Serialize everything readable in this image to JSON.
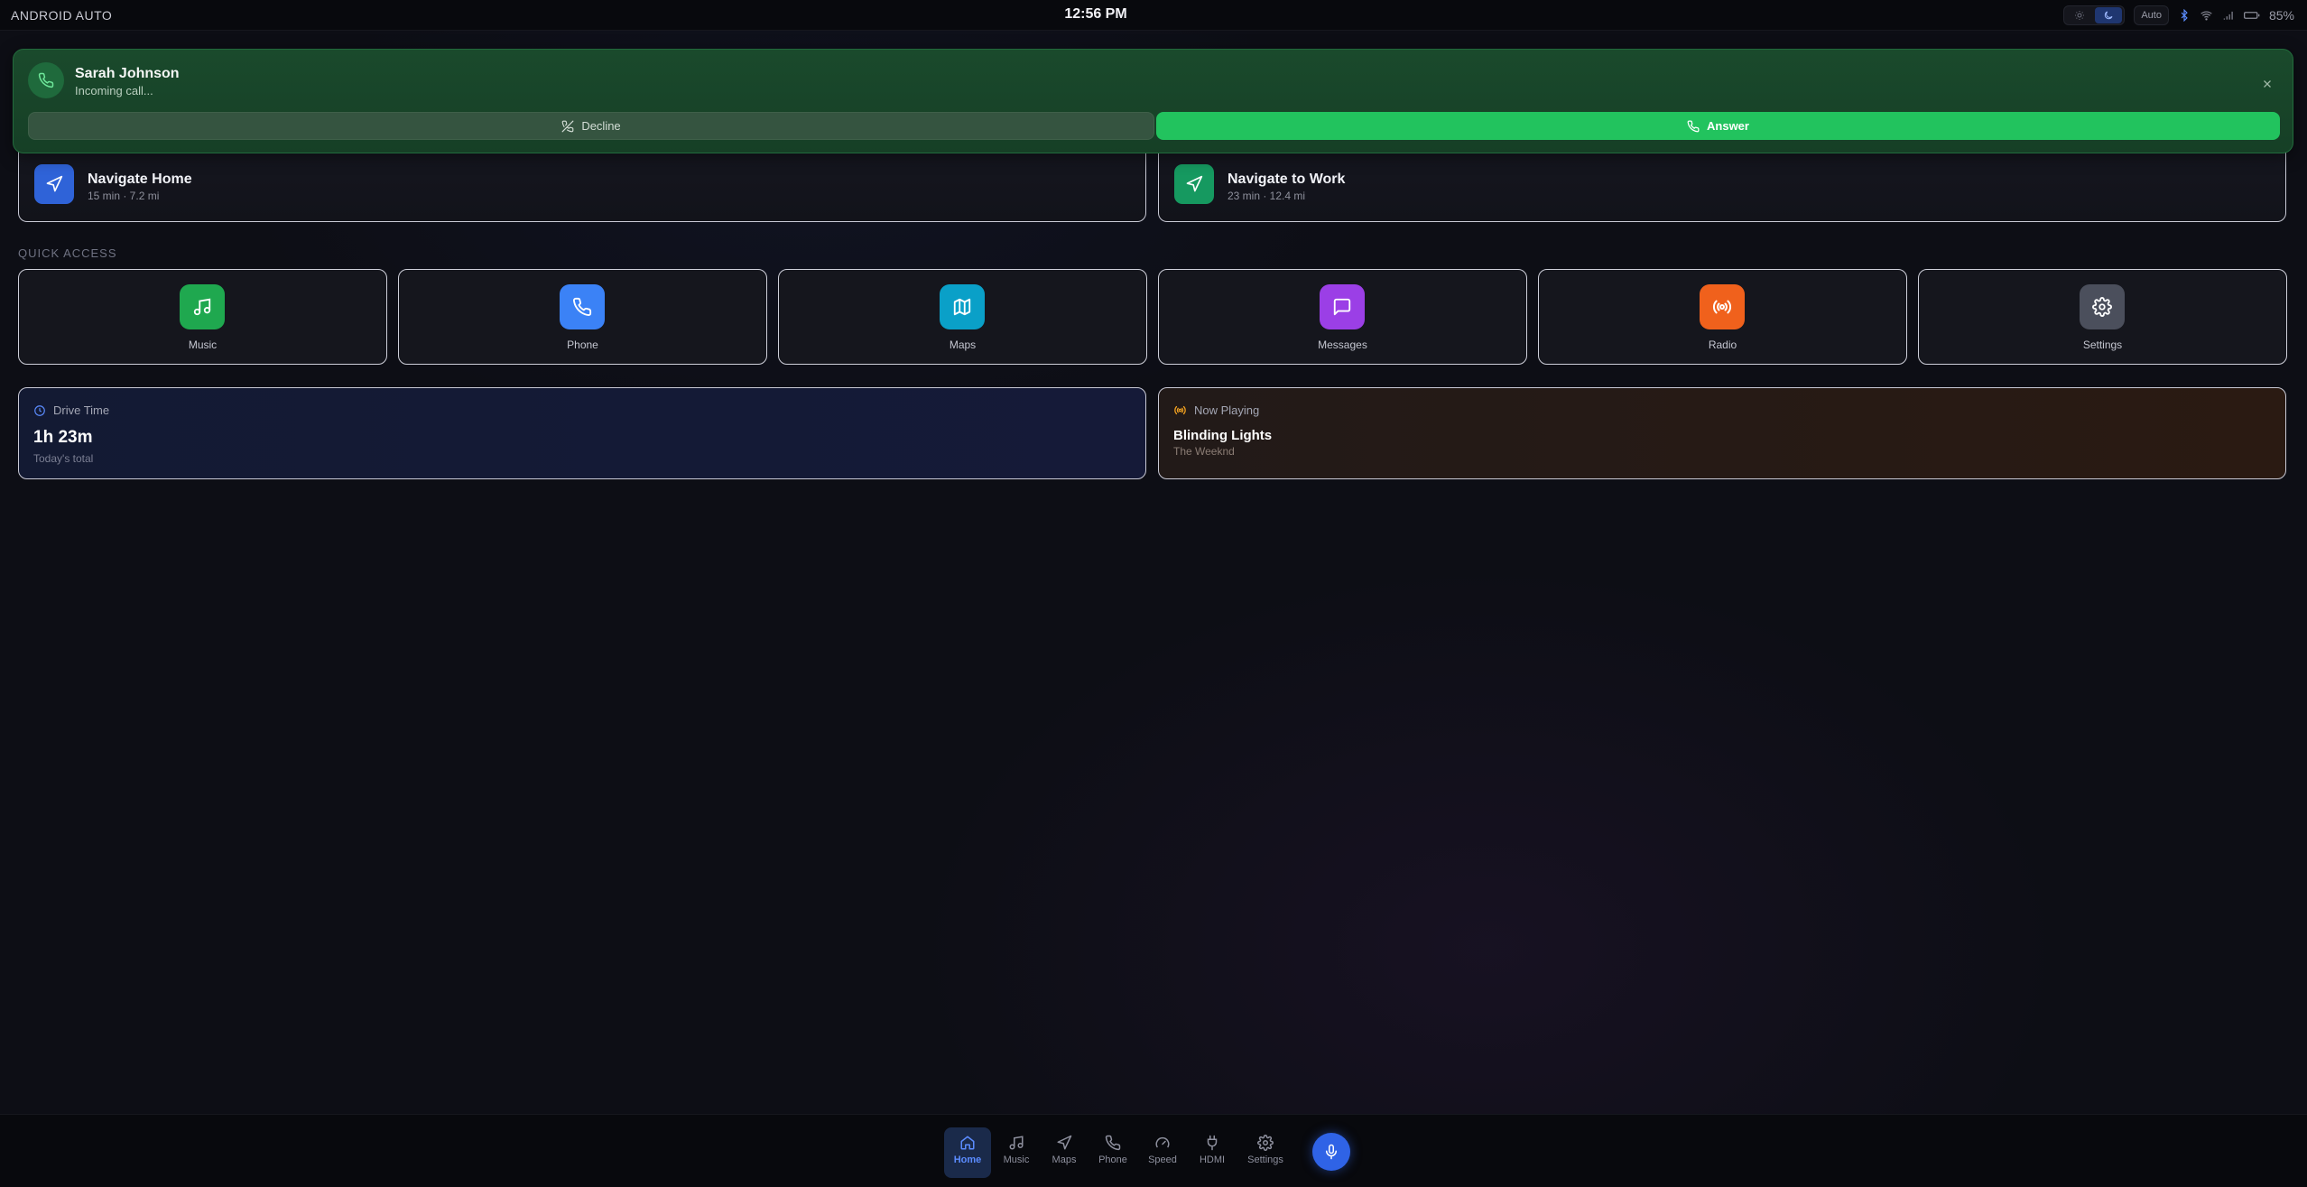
{
  "status_bar": {
    "brand": "ANDROID AUTO",
    "time": "12:56 PM",
    "theme_auto_label": "Auto",
    "battery": "85%"
  },
  "call": {
    "caller": "Sarah Johnson",
    "status": "Incoming call...",
    "decline_label": "Decline",
    "answer_label": "Answer"
  },
  "navigation": [
    {
      "title": "Navigate Home",
      "detail": "15 min · 7.2 mi"
    },
    {
      "title": "Navigate to Work",
      "detail": "23 min · 12.4 mi"
    }
  ],
  "quick_access": {
    "label": "QUICK ACCESS",
    "items": [
      {
        "label": "Music",
        "icon": "music-icon",
        "color": "#1fa84f"
      },
      {
        "label": "Phone",
        "icon": "phone-icon",
        "color": "#3b82f6"
      },
      {
        "label": "Maps",
        "icon": "map-icon",
        "color": "#0aa0c8"
      },
      {
        "label": "Messages",
        "icon": "message-icon",
        "color": "#9b3fe6"
      },
      {
        "label": "Radio",
        "icon": "radio-icon",
        "color": "#f0611c"
      },
      {
        "label": "Settings",
        "icon": "gear-icon",
        "color": "#4b4f5c"
      }
    ]
  },
  "drive_time": {
    "label": "Drive Time",
    "value": "1h 23m",
    "sub": "Today's total"
  },
  "now_playing": {
    "label": "Now Playing",
    "title": "Blinding Lights",
    "artist": "The Weeknd"
  },
  "bottom_nav": {
    "items": [
      {
        "label": "Home",
        "icon": "home-icon",
        "active": true
      },
      {
        "label": "Music",
        "icon": "music-icon"
      },
      {
        "label": "Maps",
        "icon": "navigation-icon"
      },
      {
        "label": "Phone",
        "icon": "phone-icon"
      },
      {
        "label": "Speed",
        "icon": "gauge-icon"
      },
      {
        "label": "HDMI",
        "icon": "plug-icon"
      },
      {
        "label": "Settings",
        "icon": "gear-icon"
      }
    ],
    "mic_icon": "microphone-icon"
  },
  "colors": {
    "accent": "#2f63e6",
    "answer": "#22c35e",
    "banner": "#1a4a2c"
  }
}
